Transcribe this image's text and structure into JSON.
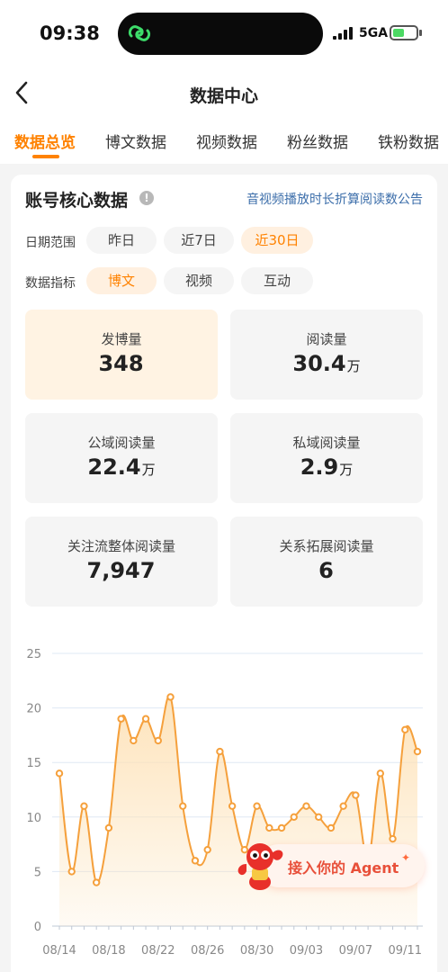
{
  "status_bar": {
    "time": "09:38",
    "network": "5GA"
  },
  "nav": {
    "title": "数据中心"
  },
  "tabs": [
    "数据总览",
    "博文数据",
    "视频数据",
    "粉丝数据",
    "铁粉数据"
  ],
  "card": {
    "title": "账号核心数据",
    "info_glyph": "!",
    "notice": "音视频播放时长折算阅读数公告"
  },
  "date_range": {
    "label": "日期范围",
    "options": [
      "昨日",
      "近7日",
      "近30日"
    ],
    "selected": "近30日"
  },
  "metric": {
    "label": "数据指标",
    "options": [
      "博文",
      "视频",
      "互动"
    ],
    "selected": "博文"
  },
  "stats": [
    {
      "label": "发博量",
      "value": "348",
      "unit": ""
    },
    {
      "label": "阅读量",
      "value": "30.4",
      "unit": "万"
    },
    {
      "label": "公域阅读量",
      "value": "22.4",
      "unit": "万"
    },
    {
      "label": "私域阅读量",
      "value": "2.9",
      "unit": "万"
    },
    {
      "label": "关注流整体阅读量",
      "value": "7,947",
      "unit": ""
    },
    {
      "label": "关系拓展阅读量",
      "value": "6",
      "unit": ""
    }
  ],
  "chart_data": {
    "type": "area",
    "y_ticks": [
      "25",
      "20",
      "15",
      "10",
      "5",
      "0"
    ],
    "ylim": [
      0,
      25
    ],
    "x_tick_labels": [
      "08/14",
      "08/18",
      "08/22",
      "08/26",
      "08/30",
      "09/03",
      "09/07",
      "09/11"
    ],
    "x": [
      "08/14",
      "08/15",
      "08/16",
      "08/17",
      "08/18",
      "08/19",
      "08/20",
      "08/21",
      "08/22",
      "08/23",
      "08/24",
      "08/25",
      "08/26",
      "08/27",
      "08/28",
      "08/29",
      "08/30",
      "08/31",
      "09/01",
      "09/02",
      "09/03",
      "09/04",
      "09/05",
      "09/06",
      "09/07",
      "09/08",
      "09/09",
      "09/10",
      "09/11",
      "09/12"
    ],
    "values": [
      14,
      5,
      11,
      4,
      9,
      19,
      17,
      19,
      17,
      21,
      11,
      6,
      7,
      16,
      11,
      7,
      11,
      9,
      9,
      10,
      11,
      10,
      9,
      11,
      12,
      6,
      14,
      8,
      18,
      16
    ],
    "line_color": "#f5a03c",
    "fill_color": "#fde2b8",
    "grid_color": "#dfe8f4"
  },
  "agent": {
    "label": "接入你的 Agent",
    "spark": "✦"
  }
}
